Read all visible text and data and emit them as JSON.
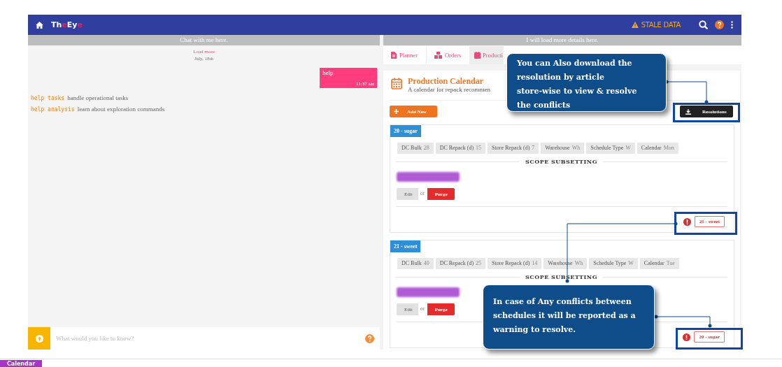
{
  "app": {
    "logo": [
      {
        "text": "Th",
        "accent": false
      },
      {
        "text": "e",
        "accent": true
      },
      {
        "text": "Ey",
        "accent": false
      },
      {
        "text": "e",
        "accent": true
      }
    ],
    "status": "STALE DATA"
  },
  "chat": {
    "header": "Chat with me here.",
    "load_more": "Load more",
    "date": "July, 18th",
    "messages": [
      {
        "kind": "user",
        "text": "help",
        "time": "11:37 am"
      },
      {
        "kind": "hint",
        "command": "help tasks",
        "text": "handle operational tasks"
      },
      {
        "kind": "hint",
        "command": "help analysis",
        "text": "learn about exploration commands"
      }
    ],
    "input": {
      "placeholder": "What would you like to know?"
    }
  },
  "details": {
    "header": "I will load more details here.",
    "tabs": [
      {
        "label": "Planner",
        "selected": false
      },
      {
        "label": "Orders",
        "selected": false
      },
      {
        "label": "Producti",
        "selected": true
      }
    ],
    "calendar": {
      "title": "Production Calendar",
      "subtitle": "A calendar for repack recommen",
      "add_button": "Add New",
      "resolutions_button": "Resolutions",
      "schedules": [
        {
          "name": "20 - sugar",
          "chips": [
            {
              "label": "DC Bulk",
              "value": "28"
            },
            {
              "label": "DC Repack (d)",
              "value": "15"
            },
            {
              "label": "Store Repack (d)",
              "value": "7"
            },
            {
              "label": "Warehouse",
              "value": "Wh"
            },
            {
              "label": "Schedule Type",
              "value": "W"
            },
            {
              "label": "Calendar",
              "value": "Mon"
            }
          ],
          "section": "SCOPE SUBSETTING",
          "edit": "Edit",
          "or": "or",
          "purge": "Purge",
          "conflict": "21 - sweet"
        },
        {
          "name": "21 - sweet",
          "chips": [
            {
              "label": "DC Bulk",
              "value": "40"
            },
            {
              "label": "DC Repack (d)",
              "value": "25"
            },
            {
              "label": "Store Repack (d)",
              "value": "14"
            },
            {
              "label": "Warehouse",
              "value": "Wh"
            },
            {
              "label": "Schedule Type",
              "value": "W"
            },
            {
              "label": "Calendar",
              "value": "Tue"
            }
          ],
          "section": "SCOPE SUBSETTING",
          "edit": "Edit",
          "or": "or",
          "purge": "Purge",
          "conflict": "20 - sugar"
        }
      ]
    }
  },
  "callouts": [
    {
      "lines": [
        "You can Also download the",
        "resolution by article",
        "store-wise to view & resolve",
        "the conflicts"
      ]
    },
    {
      "lines": [
        "In case of Any conflicts between",
        "schedules it will be reported as a",
        "warning to resolve."
      ]
    }
  ],
  "bottom_tab": {
    "label": "Calendar"
  }
}
